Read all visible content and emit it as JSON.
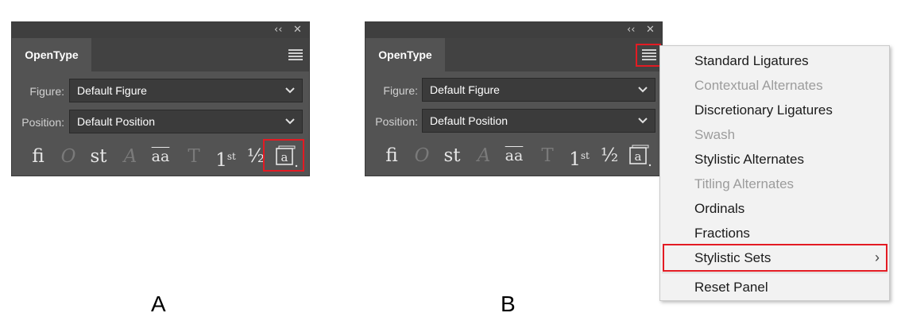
{
  "panel_a": {
    "tab_label": "OpenType",
    "figure_label": "Figure:",
    "figure_value": "Default Figure",
    "position_label": "Position:",
    "position_value": "Default Position",
    "collapse_glyph": "‹‹",
    "close_glyph": "✕",
    "caption": "A"
  },
  "panel_b": {
    "tab_label": "OpenType",
    "figure_label": "Figure:",
    "figure_value": "Default Figure",
    "position_label": "Position:",
    "position_value": "Default Position",
    "collapse_glyph": "‹‹",
    "close_glyph": "✕",
    "caption": "B"
  },
  "glyph_buttons": [
    {
      "name": "standard-ligatures-icon",
      "text": "fi",
      "enabled": true
    },
    {
      "name": "contextual-alternates-icon",
      "text": "O",
      "enabled": false
    },
    {
      "name": "discretionary-ligatures-icon",
      "text": "st",
      "enabled": true
    },
    {
      "name": "swash-icon",
      "text": "A",
      "enabled": false
    },
    {
      "name": "stylistic-alternates-icon",
      "text": "aa",
      "enabled": true
    },
    {
      "name": "titling-alternates-icon",
      "text": "T",
      "enabled": false
    },
    {
      "name": "ordinals-icon",
      "text": "1",
      "sup": "st",
      "enabled": true
    },
    {
      "name": "fractions-icon",
      "text": "½",
      "enabled": true
    },
    {
      "name": "stylistic-sets-icon",
      "text": "a",
      "enabled": true
    }
  ],
  "menu": {
    "items": [
      {
        "label": "Standard Ligatures",
        "enabled": true
      },
      {
        "label": "Contextual Alternates",
        "enabled": false
      },
      {
        "label": "Discretionary Ligatures",
        "enabled": true
      },
      {
        "label": "Swash",
        "enabled": false
      },
      {
        "label": "Stylistic Alternates",
        "enabled": true
      },
      {
        "label": "Titling Alternates",
        "enabled": false
      },
      {
        "label": "Ordinals",
        "enabled": true
      },
      {
        "label": "Fractions",
        "enabled": true
      },
      {
        "label": "Stylistic Sets",
        "enabled": true,
        "submenu": true
      },
      {
        "label": "Reset Panel",
        "enabled": true
      }
    ],
    "submenu_arrow": "›"
  },
  "colors": {
    "panel_bg": "#535353",
    "highlight_red": "#e31b23",
    "menu_bg": "#f2f2f2"
  }
}
